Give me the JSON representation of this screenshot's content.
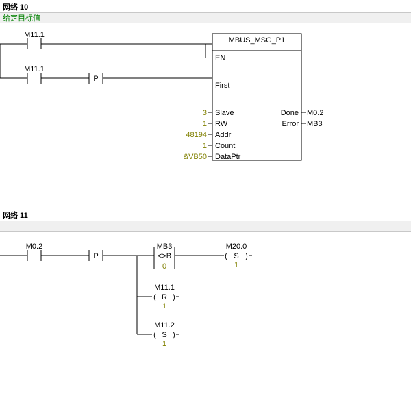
{
  "network10": {
    "title": "网络 10",
    "comment": "给定目标值",
    "contact1": "M11.1",
    "contact2": "M11.1",
    "contact2_mod": "P",
    "block": {
      "name": "MBUS_MSG_P1",
      "pins_left": {
        "en": {
          "label": "EN"
        },
        "first": {
          "label": "First"
        },
        "slave": {
          "label": "Slave",
          "value": "3"
        },
        "rw": {
          "label": "RW",
          "value": "1"
        },
        "addr": {
          "label": "Addr",
          "value": "48194"
        },
        "count": {
          "label": "Count",
          "value": "1"
        },
        "dp": {
          "label": "DataPtr",
          "value": "&VB50"
        }
      },
      "pins_right": {
        "done": {
          "label": "Done",
          "value": "M0.2"
        },
        "error": {
          "label": "Error",
          "value": "MB3"
        }
      }
    }
  },
  "network11": {
    "title": "网络 11",
    "comment": " ",
    "contact": {
      "label": "M0.2",
      "mod": "P"
    },
    "cmp": {
      "label": "MB3",
      "op": "<>B",
      "value": "0"
    },
    "coil_s1": {
      "label": "M20.0",
      "type": "S",
      "count": "1"
    },
    "coil_r": {
      "label": "M11.1",
      "type": "R",
      "count": "1"
    },
    "coil_s2": {
      "label": "M11.2",
      "type": "S",
      "count": "1"
    }
  }
}
